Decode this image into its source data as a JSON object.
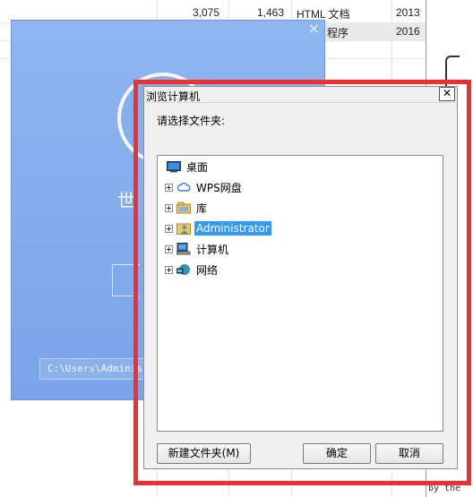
{
  "background": {
    "sheet_rows": [
      {
        "size": "3,075",
        "size2": "1,463",
        "type": "HTML 文档",
        "year": "2013"
      },
      {
        "type": "程序",
        "year": "2016"
      }
    ],
    "code_lines": [
      "by the"
    ],
    "blue_window": {
      "path_text": "C:\\Users\\Adminis",
      "title_fragment": "世"
    }
  },
  "dialog": {
    "title": "浏览计算机",
    "prompt": "请选择文件夹:",
    "tree": [
      {
        "label": "桌面",
        "icon": "desktop-icon",
        "expandable": false,
        "selected": false
      },
      {
        "label": "WPS网盘",
        "icon": "cloud-icon",
        "expandable": true,
        "selected": false
      },
      {
        "label": "库",
        "icon": "library-icon",
        "expandable": true,
        "selected": false
      },
      {
        "label": "Administrator",
        "icon": "user-folder-icon",
        "expandable": true,
        "selected": true
      },
      {
        "label": "计算机",
        "icon": "computer-icon",
        "expandable": true,
        "selected": false
      },
      {
        "label": "网络",
        "icon": "network-icon",
        "expandable": true,
        "selected": false
      }
    ],
    "buttons": {
      "new_folder": "新建文件夹(M)",
      "ok": "确定",
      "cancel": "取消"
    }
  },
  "colors": {
    "highlight_frame": "#f22f2f",
    "selection": "#3399ff",
    "app_blue": "#79a4ea"
  }
}
